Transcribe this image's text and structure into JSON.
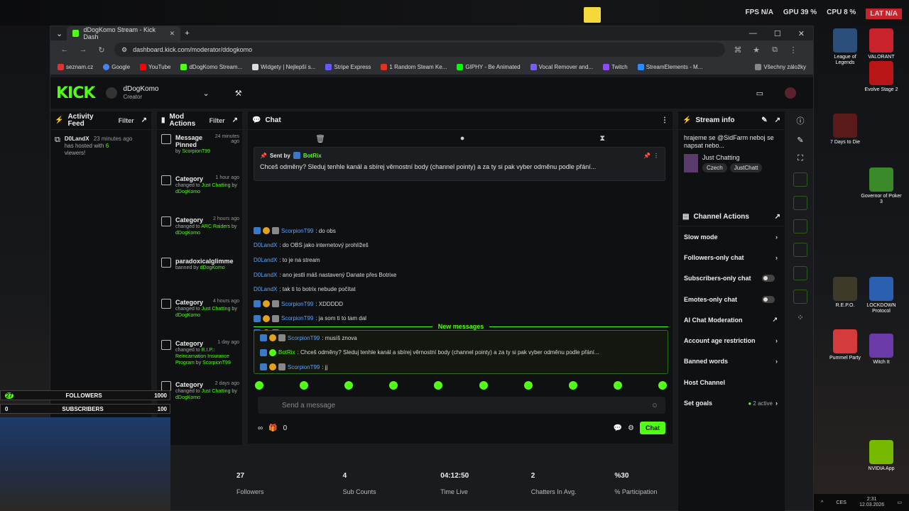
{
  "os": {
    "stats": [
      "FPS N/A",
      "GPU 39 %",
      "CPU 8 %",
      "LAT N/A"
    ]
  },
  "browser": {
    "tab_title": "dDogKomo Stream - Kick Dash",
    "url": "dashboard.kick.com/moderator/ddogkomo",
    "bookmarks": [
      "seznam.cz",
      "Google",
      "YouTube",
      "dDogKomo Stream...",
      "Widgety | Nejlepší s...",
      "Stripe Express",
      "1 Random Steam Ke...",
      "GIPHY - Be Animated",
      "Vocal Remover and...",
      "Twitch",
      "StreamElements - M...",
      "Všechny záložky"
    ]
  },
  "kick": {
    "logo": "KICK",
    "username": "dDogKomo",
    "role": "Creator"
  },
  "activity": {
    "title": "Activity Feed",
    "filter": "Filter",
    "item_user": "D0LandX",
    "item_time": "23 minutes ago",
    "item_text": "has hosted with",
    "item_count": "6",
    "item_suffix": "viewers!"
  },
  "mod": {
    "title": "Mod Actions",
    "filter": "Filter",
    "rows": [
      {
        "title": "Message Pinned",
        "time": "24 minutes ago",
        "line1": "by",
        "user": "ScorpionT99"
      },
      {
        "title": "Category",
        "time": "1 hour ago",
        "line1": "changed to",
        "value": "Just Chatting",
        "by": "by",
        "user": "dDogKomo"
      },
      {
        "title": "Category",
        "time": "2 hours ago",
        "line1": "changed to",
        "value": "ARC Raiders",
        "by": "by",
        "user": "dDogKomo"
      },
      {
        "title": "paradoxicalglimme",
        "time": "",
        "line1": "banned by",
        "user": "dDogKomo"
      },
      {
        "title": "Category",
        "time": "4 hours ago",
        "line1": "changed to",
        "value": "Just Chatting",
        "by": "by",
        "user": "dDogKomo"
      },
      {
        "title": "Category",
        "time": "1 day ago",
        "line1": "changed to",
        "value": "R.I.P.: Reincarnation Insurance Program",
        "by": "by",
        "user": "ScorpionT99"
      },
      {
        "title": "Category",
        "time": "2 days ago",
        "line1": "changed to",
        "value": "Just Chatting",
        "by": "by",
        "user": "dDogKomo"
      }
    ]
  },
  "chat": {
    "title": "Chat",
    "pinned_sentby": "Sent by",
    "pinned_user": "BotRix",
    "pinned_text": "Chceš odměny? Sleduj tenhle kanál a sbírej věrnostní body (channel pointy) a za ty si pak vyber odměnu podle přání...",
    "messages": [
      {
        "user": "ScorpionT99",
        "text": ": do obs",
        "badges": true
      },
      {
        "user": "D0LandX",
        "text": ": do OBS jako internetový prohlížeš",
        "badges": false
      },
      {
        "user": "D0LandX",
        "text": ": to je na stream",
        "badges": false
      },
      {
        "user": "D0LandX",
        "text": ": ano jestli máš nastavený Danate přes Botrixe",
        "badges": false
      },
      {
        "user": "D0LandX",
        "text": ": tak ti to botrix nebude počítat",
        "badges": false
      },
      {
        "user": "ScorpionT99",
        "text": ": XDDDDD",
        "badges": true
      },
      {
        "user": "ScorpionT99",
        "text": ": ja som ti to tam dal",
        "badges": true
      },
      {
        "user": "ScorpionT99",
        "text": ": jj",
        "badges": true
      }
    ],
    "new_label": "New messages",
    "new_messages": [
      {
        "user": "ScorpionT99",
        "text": ": musíš znova"
      },
      {
        "user": "BotRix",
        "text": ": Chceš odměny? Sleduj tenhle kanál a sbírej věrnostní body (channel pointy) a za ty si pak vyber odměnu podle přání..."
      },
      {
        "user": "ScorpionT99",
        "text": ": jj"
      }
    ],
    "placeholder": "Send a message",
    "count": "0",
    "send": "Chat"
  },
  "stream_info": {
    "title": "Stream info",
    "stream_title": "hrajeme se @SidFarm neboj se napsat nebo...",
    "category": "Just Chatting",
    "tags": [
      "Czech",
      "JustChatt"
    ]
  },
  "channel_actions": {
    "title": "Channel Actions",
    "items": [
      {
        "label": "Slow mode",
        "ctl": "arrow"
      },
      {
        "label": "Followers-only chat",
        "ctl": "arrow"
      },
      {
        "label": "Subscribers-only chat",
        "ctl": "toggle"
      },
      {
        "label": "Emotes-only chat",
        "ctl": "toggle"
      },
      {
        "label": "AI Chat Moderation",
        "ctl": "ext"
      },
      {
        "label": "Account age restriction",
        "ctl": "arrow"
      },
      {
        "label": "Banned words",
        "ctl": "arrow"
      },
      {
        "label": "Host Channel",
        "ctl": "none"
      },
      {
        "label": "Set goals",
        "ctl": "arrow"
      }
    ],
    "goals_status": "2 active"
  },
  "summary": [
    {
      "value": "27",
      "label": "Followers"
    },
    {
      "value": "4",
      "label": "Sub Counts"
    },
    {
      "value": "04:12:50",
      "label": "Time Live"
    },
    {
      "value": "2",
      "label": "Chatters In Avg."
    },
    {
      "value": "%30",
      "label": "% Participation"
    }
  ],
  "overlay": {
    "followers_label": "FOLLOWERS",
    "followers_badge": "27",
    "followers_goal": "1000",
    "subs_label": "SUBSCRIBERS",
    "subs_badge": "0",
    "subs_goal": "100"
  },
  "desktop": [
    {
      "label": "League of Legends",
      "color": "#2a4f7a"
    },
    {
      "label": "VALORANT",
      "color": "#c8232c"
    },
    {
      "label": "Evolve Stage 2",
      "color": "#b81616"
    },
    {
      "label": "7 Days to Die",
      "color": "#5a1a1a"
    },
    {
      "label": "Governor of Poker 3",
      "color": "#3a8a2a"
    },
    {
      "label": "R.E.P.O.",
      "color": "#3d3a2a"
    },
    {
      "label": "LOCKDOWN Protocol",
      "color": "#2b5fb0"
    },
    {
      "label": "Pummel Party",
      "color": "#d43b3b"
    },
    {
      "label": "Witch It",
      "color": "#6a3aa8"
    },
    {
      "label": "NVIDIA App",
      "color": "#76b900"
    }
  ],
  "taskbar": {
    "lang": "CES",
    "time": "2:31",
    "date": "12.03.2026"
  }
}
